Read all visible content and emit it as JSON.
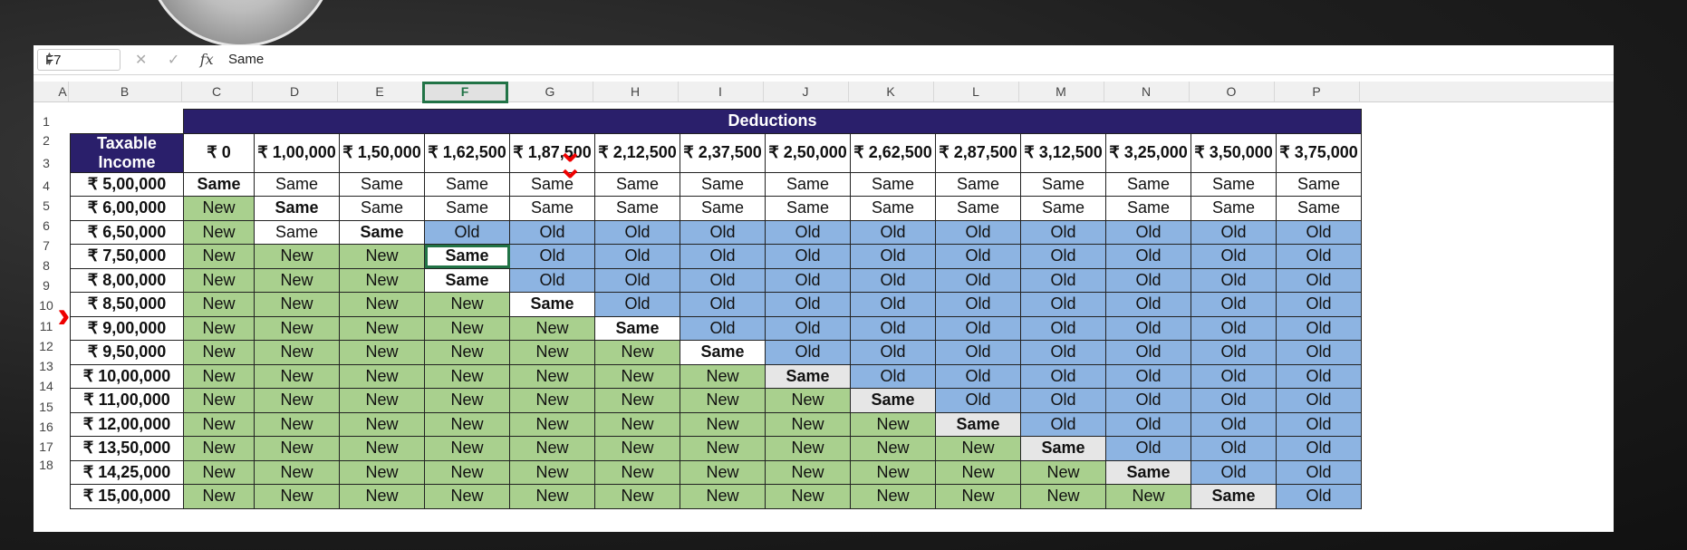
{
  "formula_bar": {
    "cell_ref": "F7",
    "value": "Same",
    "fx": "fx"
  },
  "column_headers": [
    "A",
    "B",
    "C",
    "D",
    "E",
    "F",
    "G",
    "H",
    "I",
    "J",
    "K",
    "L",
    "M",
    "N",
    "O",
    "P"
  ],
  "row_numbers": [
    "1",
    "2",
    "3",
    "4",
    "5",
    "6",
    "7",
    "8",
    "9",
    "10",
    "11",
    "12",
    "13",
    "14",
    "15",
    "16",
    "17",
    "18"
  ],
  "table": {
    "deductions_title": "Deductions",
    "taxable_income_title": "Taxable Income",
    "deduction_headers": [
      "₹ 0",
      "₹ 1,00,000",
      "₹ 1,50,000",
      "₹ 1,62,500",
      "₹ 1,87,500",
      "₹ 2,12,500",
      "₹ 2,37,500",
      "₹ 2,50,000",
      "₹ 2,62,500",
      "₹ 2,87,500",
      "₹ 3,12,500",
      "₹ 3,25,000",
      "₹ 3,50,000",
      "₹ 3,75,000"
    ],
    "incomes": [
      "₹ 5,00,000",
      "₹ 6,00,000",
      "₹ 6,50,000",
      "₹ 7,50,000",
      "₹ 8,00,000",
      "₹ 8,50,000",
      "₹ 9,00,000",
      "₹ 9,50,000",
      "₹ 10,00,000",
      "₹ 11,00,000",
      "₹ 12,00,000",
      "₹ 13,50,000",
      "₹ 14,25,000",
      "₹ 15,00,000"
    ],
    "labels": {
      "new": "New",
      "old": "Old",
      "same": "Same"
    },
    "same_column_index": [
      0,
      1,
      2,
      3,
      4,
      5,
      6,
      7,
      8,
      9,
      10,
      11,
      12,
      13
    ],
    "same_start_old": [
      99,
      2,
      3,
      4,
      5,
      6,
      7,
      8,
      9,
      10,
      11,
      12,
      13,
      99
    ],
    "colors": {
      "new": "#a9d08e",
      "old": "#8db4e2",
      "header": "#2a1f6b",
      "selection": "#217346"
    }
  }
}
